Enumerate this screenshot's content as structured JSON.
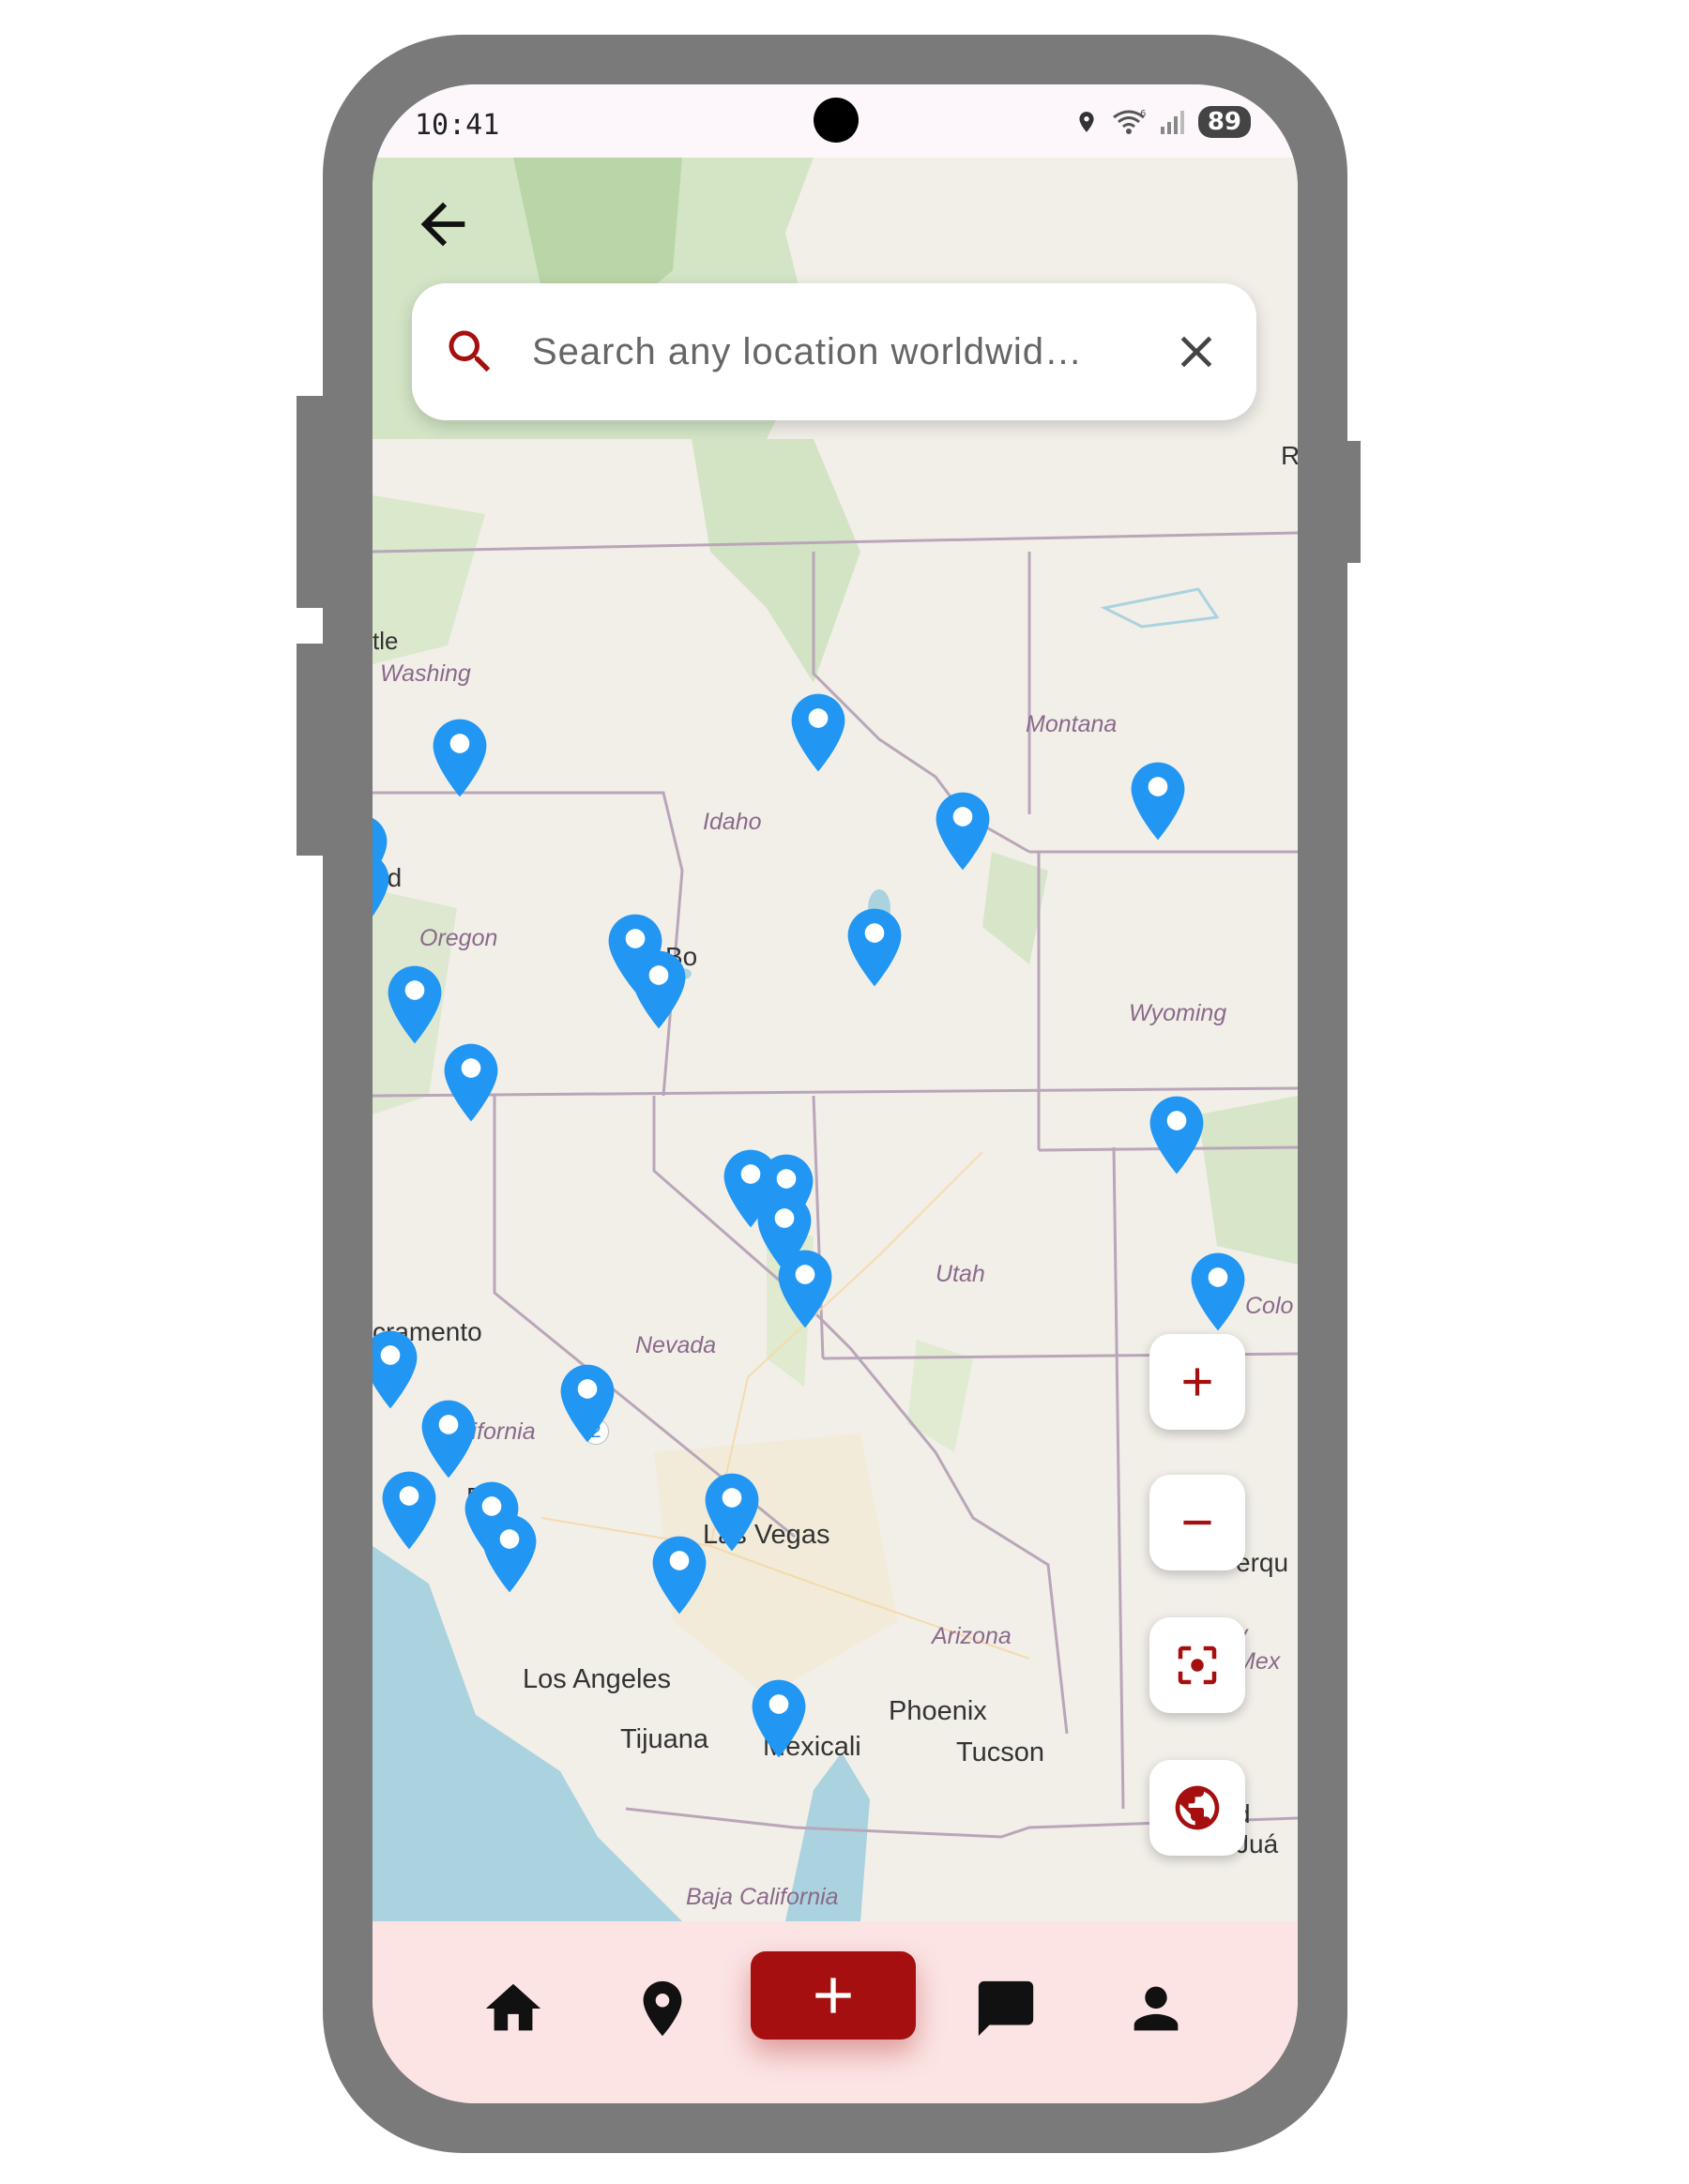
{
  "status_bar": {
    "time": "10:41",
    "battery": "89"
  },
  "search": {
    "placeholder": "Search any location worldwid…"
  },
  "map": {
    "labels": {
      "washington": "Washing",
      "seattle": "tle",
      "oregon": "Oregon",
      "portland": "nd",
      "idaho": "Idaho",
      "boise": "Bo",
      "montana": "Montana",
      "wyoming": "Wyoming",
      "nevada": "Nevada",
      "utah": "Utah",
      "colorado": "Colo",
      "california": "California",
      "sacramento": "cramento",
      "fresno": "Fre",
      "las_vegas": "Las Vegas",
      "los_angeles": "Los Angeles",
      "tijuana": "Tijuana",
      "mexicali": "Mexicali",
      "arizona": "Arizona",
      "phoenix": "Phoenix",
      "tucson": "Tucson",
      "albuquerque": "erqu",
      "new_mexico": "v Mex",
      "juarez": "d Juá",
      "baja_california": "Baja California",
      "regina_fragment": "R",
      "route_shield": "2"
    },
    "marker_count": 26,
    "marker_color": "#2196f3"
  },
  "controls": {
    "zoom_in": "zoom-in",
    "zoom_out": "zoom-out",
    "recenter": "recenter",
    "globe": "globe"
  },
  "nav": {
    "items": [
      "home",
      "location",
      "add",
      "messages",
      "profile"
    ],
    "accent": "#a50f0f",
    "background": "#fce4e4"
  }
}
